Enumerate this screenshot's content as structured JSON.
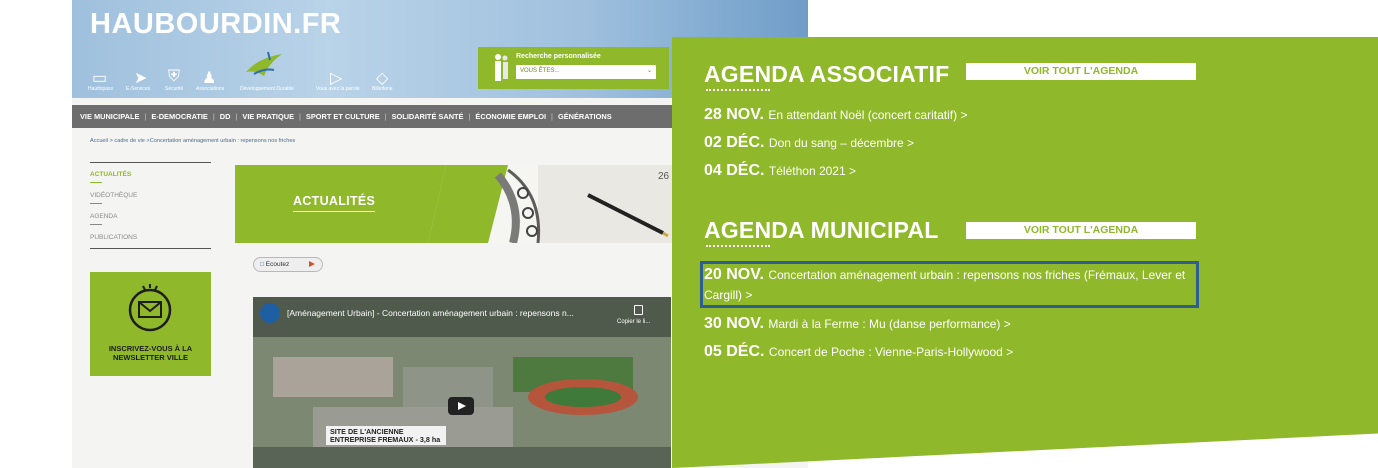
{
  "left_site": {
    "title": "HAUBOURDIN.FR",
    "header_icons": [
      {
        "label": "Hautbipass",
        "icon": "card-icon"
      },
      {
        "label": "E-Services",
        "icon": "cursor-icon"
      },
      {
        "label": "Sécurité",
        "icon": "shield-icon"
      },
      {
        "label": "Associations",
        "icon": "people-icon"
      },
      {
        "label": "Développement Durable",
        "icon": "bird-logo-icon"
      },
      {
        "label": "Vous avez la parole",
        "icon": "megaphone-icon"
      },
      {
        "label": "Billetterie",
        "icon": "ticket-icon"
      }
    ],
    "recherche": {
      "title": "Recherche personnalisée",
      "select_value": "VOUS ÊTES..."
    },
    "nav": [
      "VIE MUNICIPALE",
      "E-DEMOCRATIE",
      "DD",
      "VIE PRATIQUE",
      "SPORT ET CULTURE",
      "SOLIDARITÉ SANTÉ",
      "ÉCONOMIE EMPLOI",
      "GÉNÉRATIONS"
    ],
    "breadcrumb": "Accueil > cadre de vie >Concertation aménagement urbain : repensons nos friches",
    "side_menu": [
      "ACTUALITÉS",
      "VIDÉOTHÈQUE",
      "AGENDA",
      "PUBLICATIONS"
    ],
    "newsletter": "INSCRIVEZ-VOUS À LA NEWSLETTER VILLE",
    "banner": "ACTUALITÉS",
    "ecoutez": "Ecoutez",
    "video": {
      "title": "[Aménagement Urbain] - Concertation aménagement urbain : repensons n...",
      "copy_link": "Copier le li...",
      "site_label": "SITE DE L'ANCIENNE ENTREPRISE FREMAUX - 3,8 ha"
    }
  },
  "agenda_associatif": {
    "title": "AGENDA ASSOCIATIF",
    "button": "VOIR TOUT L'AGENDA",
    "events": [
      {
        "date": "28 NOV.",
        "text": "En attendant Noël (concert caritatif) >"
      },
      {
        "date": "02 DÉC.",
        "text": "Don du sang – décembre >"
      },
      {
        "date": "04 DÉC.",
        "text": "Téléthon 2021 >"
      }
    ]
  },
  "agenda_municipal": {
    "title": "AGENDA MUNICIPAL",
    "button": "VOIR TOUT L'AGENDA",
    "events": [
      {
        "date": "20 NOV.",
        "text": "Concertation aménagement urbain : repensons nos friches (Frémaux, Lever et Cargill) >"
      },
      {
        "date": "30 NOV.",
        "text": "Mardi à la Ferme : Mu (danse performance) >"
      },
      {
        "date": "05 DÉC.",
        "text": "Concert de Poche : Vienne-Paris-Hollywood >"
      }
    ]
  },
  "colors": {
    "green": "#8fb82a",
    "nav_gray": "#6d6d6d",
    "highlight": "#2e5d90"
  }
}
